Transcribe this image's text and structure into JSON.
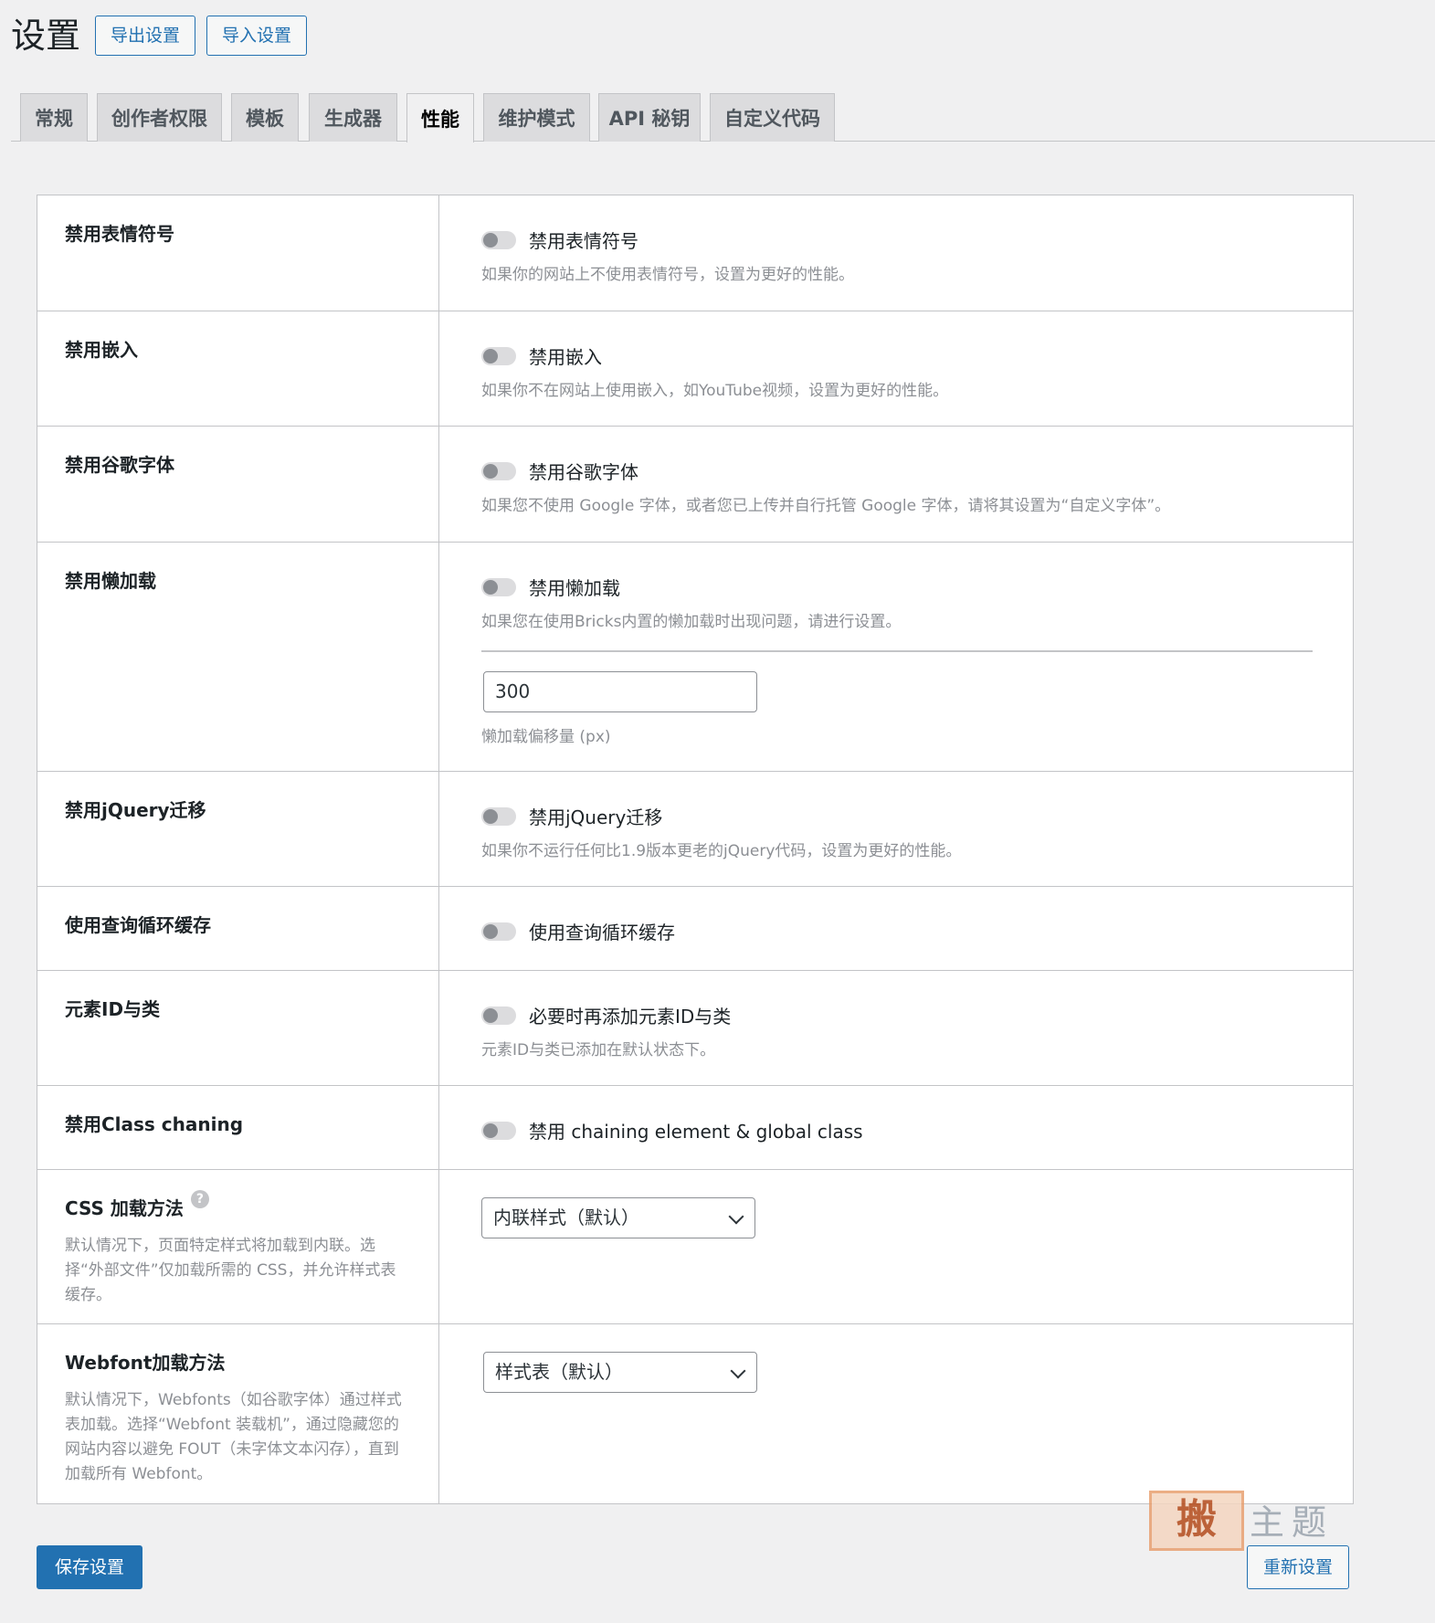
{
  "header": {
    "title": "设置",
    "export_label": "导出设置",
    "import_label": "导入设置"
  },
  "tabs": [
    {
      "label": "常规"
    },
    {
      "label": "创作者权限"
    },
    {
      "label": "模板"
    },
    {
      "label": "生成器"
    },
    {
      "label": "性能",
      "active": true
    },
    {
      "label": "维护模式"
    },
    {
      "label": "API 秘钥"
    },
    {
      "label": "自定义代码"
    }
  ],
  "rows": {
    "emoji": {
      "label": "禁用表情符号",
      "toggle_label": "禁用表情符号",
      "desc": "如果你的网站上不使用表情符号，设置为更好的性能。",
      "enabled": false
    },
    "embed": {
      "label": "禁用嵌入",
      "toggle_label": "禁用嵌入",
      "desc": "如果你不在网站上使用嵌入，如YouTube视频，设置为更好的性能。",
      "enabled": false
    },
    "google_fonts": {
      "label": "禁用谷歌字体",
      "toggle_label": "禁用谷歌字体",
      "desc": "如果您不使用 Google 字体，或者您已上传并自行托管 Google 字体，请将其设置为“自定义字体”。",
      "enabled": false
    },
    "lazy": {
      "label": "禁用懒加载",
      "toggle_label": "禁用懒加载",
      "desc": "如果您在使用Bricks内置的懒加载时出现问题，请进行设置。",
      "enabled": false,
      "offset_value": "300",
      "offset_desc": "懒加载偏移量 (px)"
    },
    "jquery": {
      "label": "禁用jQuery迁移",
      "toggle_label": "禁用jQuery迁移",
      "desc": "如果你不运行任何比1.9版本更老的jQuery代码，设置为更好的性能。",
      "enabled": false
    },
    "query_cache": {
      "label": "使用查询循环缓存",
      "toggle_label": "使用查询循环缓存",
      "enabled": false
    },
    "element_id": {
      "label": "元素ID与类",
      "toggle_label": "必要时再添加元素ID与类",
      "desc": "元素ID与类已添加在默认状态下。",
      "enabled": false
    },
    "class_chaining": {
      "label": "禁用Class chaning",
      "toggle_label": "禁用 chaining element & global class",
      "enabled": false
    },
    "css_loading": {
      "label": "CSS 加载方法",
      "help": "?",
      "desc": "默认情况下，页面特定样式将加载到内联。选择“外部文件”仅加载所需的 CSS，并允许样式表缓存。",
      "selected": "内联样式（默认）"
    },
    "webfont_loading": {
      "label": "Webfont加载方法",
      "desc": "默认情况下，Webfonts（如谷歌字体）通过样式表加载。选择“Webfont 装载机”，通过隐藏您的网站内容以避免 FOUT（未字体文本闪存），直到加载所有 Webfont。",
      "selected": "样式表（默认）"
    }
  },
  "footer": {
    "save_label": "保存设置",
    "reset_label": "重新设置"
  },
  "watermark": {
    "box_char": "搬",
    "text": "主题"
  },
  "colors": {
    "primary": "#2271b1",
    "background": "#f0f0f1",
    "muted_text": "#8c8f94"
  }
}
